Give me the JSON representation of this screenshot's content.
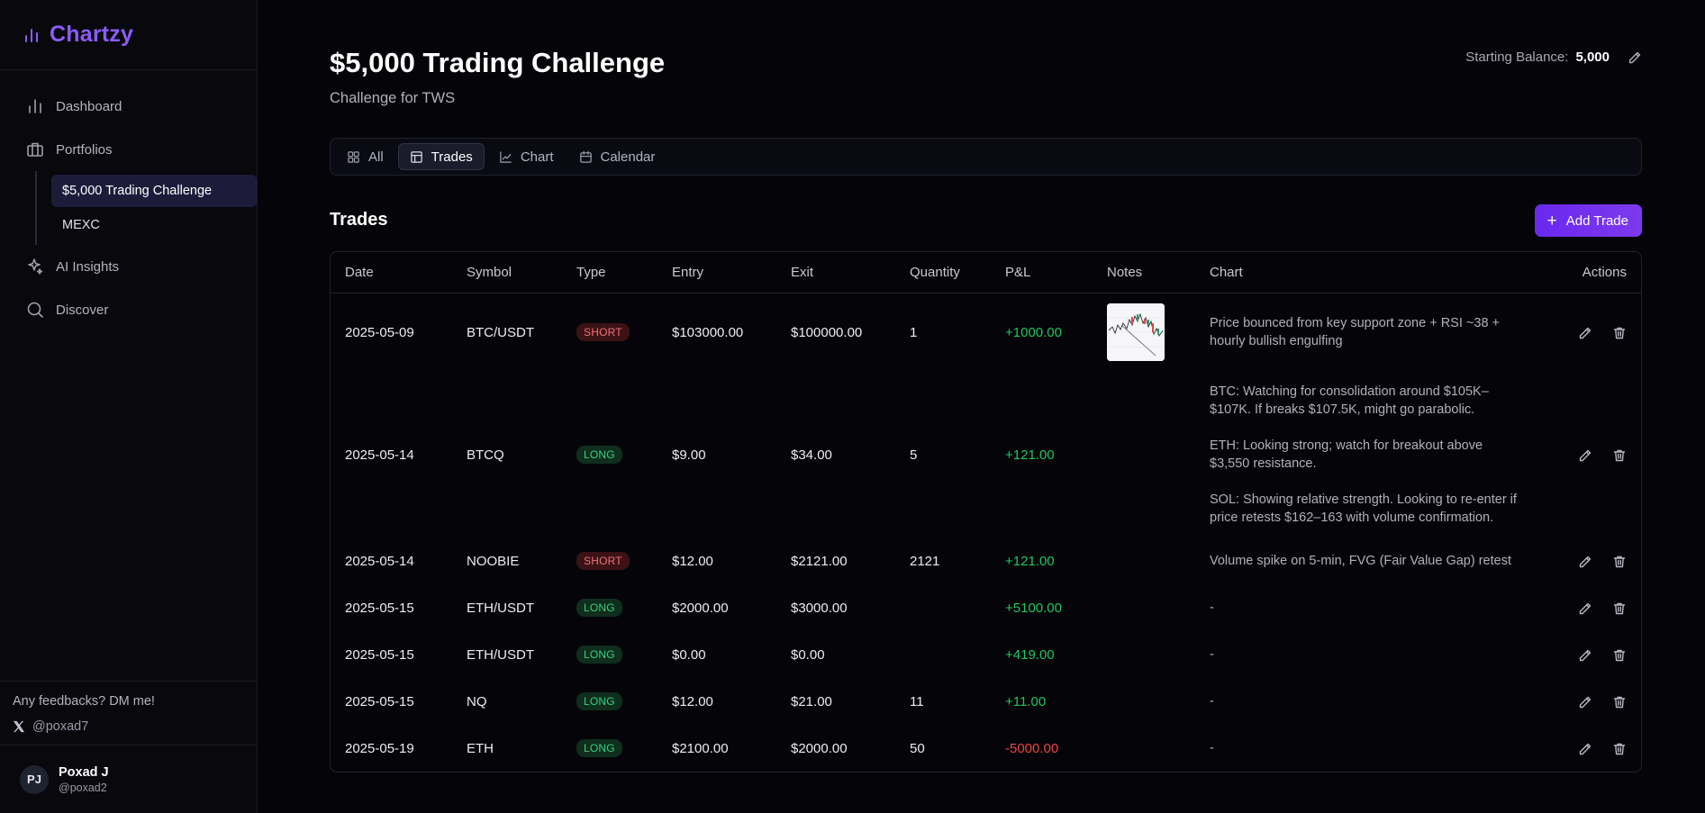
{
  "app": {
    "name": "Chartzy",
    "accent": "#8b5cf6"
  },
  "sidebar": {
    "items": [
      {
        "label": "Dashboard",
        "icon": "bar-chart-icon"
      },
      {
        "label": "Portfolios",
        "icon": "briefcase-icon"
      },
      {
        "label": "AI Insights",
        "icon": "sparkles-icon"
      },
      {
        "label": "Discover",
        "icon": "search-icon"
      }
    ],
    "portfolios": [
      {
        "label": "$5,000 Trading Challenge",
        "active": true
      },
      {
        "label": "MEXC",
        "active": false
      }
    ],
    "feedback": "Any feedbacks? DM me!",
    "twitter": "@poxad7",
    "user": {
      "initials": "PJ",
      "name": "Poxad J",
      "handle": "@poxad2"
    }
  },
  "header": {
    "title": "$5,000 Trading Challenge",
    "subtitle": "Challenge for TWS",
    "balance_label": "Starting Balance:",
    "balance_value": "5,000"
  },
  "tabs": [
    {
      "label": "All",
      "icon": "grid-icon"
    },
    {
      "label": "Trades",
      "icon": "table-icon",
      "active": true
    },
    {
      "label": "Chart",
      "icon": "line-chart-icon"
    },
    {
      "label": "Calendar",
      "icon": "calendar-icon"
    }
  ],
  "trades": {
    "title": "Trades",
    "add_label": "Add Trade",
    "columns": [
      "Date",
      "Symbol",
      "Type",
      "Entry",
      "Exit",
      "Quantity",
      "P&L",
      "Notes",
      "Chart",
      "Actions"
    ],
    "rows": [
      {
        "date": "2025-05-09",
        "symbol": "BTC/USDT",
        "type": "SHORT",
        "entry": "$103000.00",
        "exit": "$100000.00",
        "qty": "1",
        "pnl": "+1000.00",
        "has_image": true,
        "chart": [
          "Price bounced from key support zone + RSI ~38 + hourly bullish engulfing"
        ]
      },
      {
        "date": "2025-05-14",
        "symbol": "BTCQ",
        "type": "LONG",
        "entry": "$9.00",
        "exit": "$34.00",
        "qty": "5",
        "pnl": "+121.00",
        "has_image": false,
        "chart": [
          "BTC: Watching for consolidation around $105K–$107K. If breaks $107.5K, might go parabolic.",
          "ETH: Looking strong; watch for breakout above $3,550 resistance.",
          "SOL: Showing relative strength. Looking to re-enter if price retests $162–163 with volume confirmation."
        ]
      },
      {
        "date": "2025-05-14",
        "symbol": "NOOBIE",
        "type": "SHORT",
        "entry": "$12.00",
        "exit": "$2121.00",
        "qty": "2121",
        "pnl": "+121.00",
        "has_image": false,
        "chart": [
          "Volume spike on 5-min, FVG (Fair Value Gap) retest"
        ]
      },
      {
        "date": "2025-05-15",
        "symbol": "ETH/USDT",
        "type": "LONG",
        "entry": "$2000.00",
        "exit": "$3000.00",
        "qty": "",
        "pnl": "+5100.00",
        "has_image": false,
        "chart": [
          "-"
        ]
      },
      {
        "date": "2025-05-15",
        "symbol": "ETH/USDT",
        "type": "LONG",
        "entry": "$0.00",
        "exit": "$0.00",
        "qty": "",
        "pnl": "+419.00",
        "has_image": false,
        "chart": [
          "-"
        ]
      },
      {
        "date": "2025-05-15",
        "symbol": "NQ",
        "type": "LONG",
        "entry": "$12.00",
        "exit": "$21.00",
        "qty": "11",
        "pnl": "+11.00",
        "has_image": false,
        "chart": [
          "-"
        ]
      },
      {
        "date": "2025-05-19",
        "symbol": "ETH",
        "type": "LONG",
        "entry": "$2100.00",
        "exit": "$2000.00",
        "qty": "50",
        "pnl": "-5000.00",
        "has_image": false,
        "chart": [
          "-"
        ]
      }
    ]
  },
  "colors": {
    "positive": "#22c55e",
    "negative": "#ef4444",
    "short_badge": "#f07178",
    "long_badge": "#35d07f",
    "button": "#7c3aed"
  }
}
